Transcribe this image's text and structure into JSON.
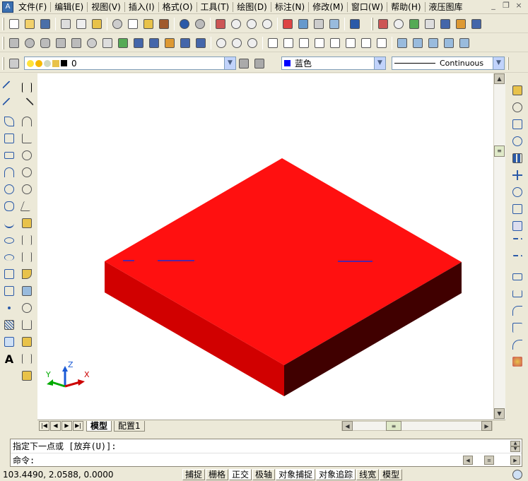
{
  "menu": {
    "items": [
      "文件(F)",
      "编辑(E)",
      "视图(V)",
      "插入(I)",
      "格式(O)",
      "工具(T)",
      "绘图(D)",
      "标注(N)",
      "修改(M)",
      "窗口(W)",
      "帮助(H)",
      "液压图库"
    ]
  },
  "layer_toolbar": {
    "layer_value": "0",
    "color_value": "蓝色",
    "linetype_value": "Continuous"
  },
  "colors": {
    "box_top": "#ff1010",
    "box_left_side": "#d10000",
    "box_right_side": "#400000",
    "layer_color_swatch": "#0000ff",
    "ucs_x": "#cc0000",
    "ucs_y": "#00aa00",
    "ucs_z": "#1a5ad6"
  },
  "ucs": {
    "x_label": "X",
    "y_label": "Y",
    "z_label": "Z"
  },
  "tabs": {
    "model": "模型",
    "layout": "配置1"
  },
  "command": {
    "history_line": "指定下一点或 [放弃(U)]:",
    "prompt": "命令:"
  },
  "status": {
    "coordinates": "103.4490,  2.0588,  0.0000",
    "toggles": [
      "捕捉",
      "栅格",
      "正交",
      "极轴",
      "对象捕捉",
      "对象追踪",
      "线宽",
      "模型"
    ]
  }
}
